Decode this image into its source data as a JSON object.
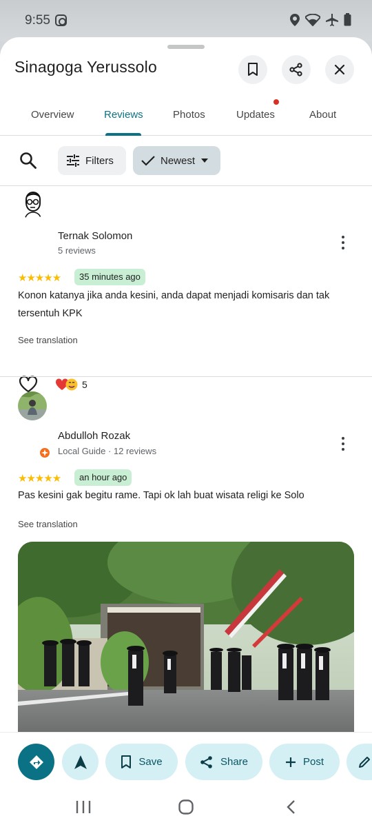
{
  "status": {
    "time": "9:55"
  },
  "place": {
    "title": "Sinagoga Yerussolo"
  },
  "tabs": [
    {
      "label": "Overview"
    },
    {
      "label": "Reviews"
    },
    {
      "label": "Photos"
    },
    {
      "label": "Updates"
    },
    {
      "label": "About"
    }
  ],
  "toolbar": {
    "filters_label": "Filters",
    "sort_label": "Newest"
  },
  "reviews": [
    {
      "name": "Ternak Solomon",
      "meta": "5 reviews",
      "stars": "★★★★★",
      "time": "35 minutes ago",
      "text": "Konon katanya jika anda kesini, anda dapat menjadi komisaris dan tak tersentuh KPK",
      "see_translation": "See translation",
      "reaction_count": "5"
    },
    {
      "name": "Abdulloh Rozak",
      "meta": "Local Guide · 12 reviews",
      "stars": "★★★★★",
      "time": "an hour ago",
      "text": "Pas kesini gak begitu rame. Tapi ok lah buat wisata religi ke Solo",
      "see_translation": "See translation"
    }
  ],
  "actions": {
    "save": "Save",
    "share": "Share",
    "post": "Post"
  },
  "colors": {
    "accent": "#0b7285",
    "chip_light": "#d4f0f5",
    "badge_green": "#c8efd4",
    "star": "#fbbc04"
  }
}
